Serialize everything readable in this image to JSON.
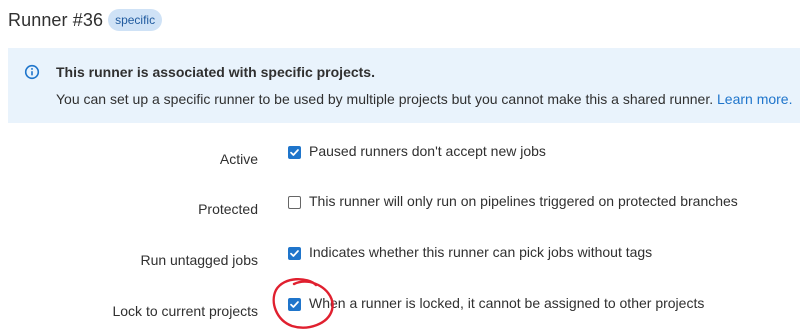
{
  "runner": {
    "title": "Runner #36",
    "badge": "specific"
  },
  "alert": {
    "icon": "info-icon",
    "title": "This runner is associated with specific projects.",
    "body": "You can set up a specific runner to be used by multiple projects but you cannot make this a shared runner.",
    "link": "Learn more."
  },
  "settings": [
    {
      "label": "Active",
      "checked": true,
      "description": "Paused runners don't accept new jobs"
    },
    {
      "label": "Protected",
      "checked": false,
      "description": "This runner will only run on pipelines triggered on protected branches"
    },
    {
      "label": "Run untagged jobs",
      "checked": true,
      "description": "Indicates whether this runner can pick jobs without tags"
    },
    {
      "label": "Lock to current projects",
      "checked": true,
      "description": "When a runner is locked, it cannot be assigned to other projects"
    }
  ],
  "colors": {
    "accent": "#1f75cb",
    "alert_bg": "#e9f3fc",
    "badge_bg": "#cfe2f6",
    "annotation": "#e0202f"
  }
}
